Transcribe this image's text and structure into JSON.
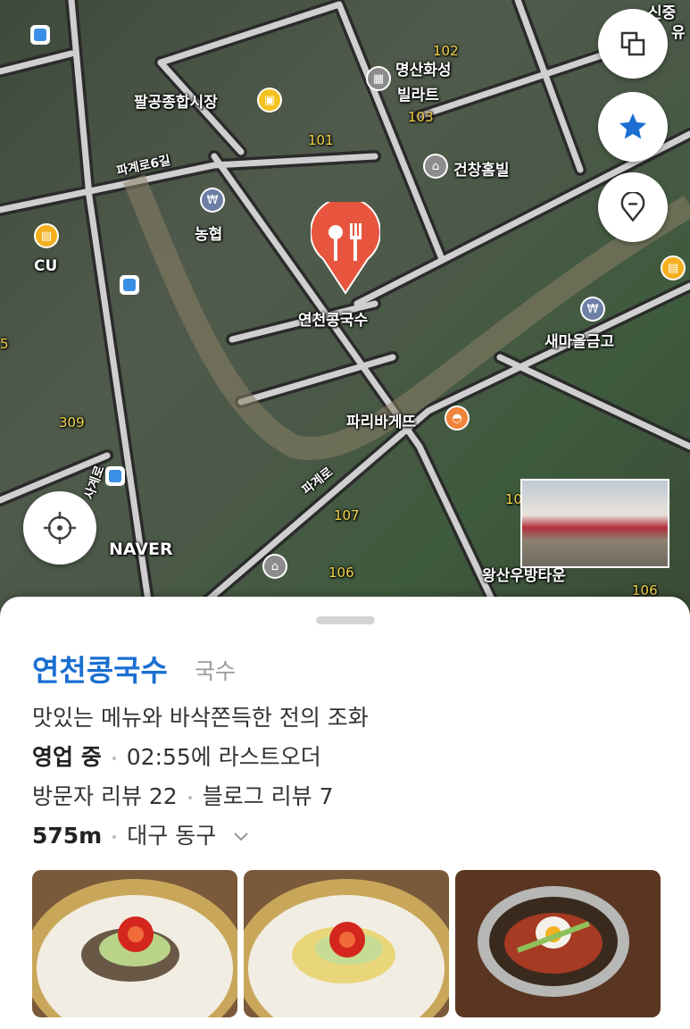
{
  "map": {
    "place_labels": {
      "market": "팔공종합시장",
      "myungsan": "명산화성",
      "villart": "빌라트",
      "num102": "102",
      "num103": "103",
      "num101": "101",
      "geonchang": "건창홈빌",
      "road6": "파계로6길",
      "nonghyup": "농협",
      "cu": "CU",
      "pin_name": "연천콩국수",
      "saemaeul": "새마을금고",
      "paris": "파리바게뜨",
      "road": "파계로",
      "num309": "309",
      "num107": "107",
      "num106a": "106",
      "wangsan": "왕산우방타운",
      "num106b": "106",
      "naver": "NAVER",
      "shingong": "신중",
      "yu": "유",
      "num5": "5",
      "num10": "10",
      "road_left": "사계로"
    },
    "icons": [
      "layers-icon",
      "star-icon",
      "location-pin-outline-icon",
      "current-location-icon"
    ],
    "accent_color": "#1a6fd1",
    "pin_color": "#e8553e"
  },
  "sheet": {
    "name": "연천콩국수",
    "category": "국수",
    "description": "맛있는 메뉴와 바삭쫀득한 전의 조화",
    "status": "영업 중",
    "last_order": "02:55에 라스트오더",
    "visitor_reviews": "방문자 리뷰 22",
    "blog_reviews": "블로그 리뷰 7",
    "distance": "575m",
    "address": "대구 동구"
  }
}
